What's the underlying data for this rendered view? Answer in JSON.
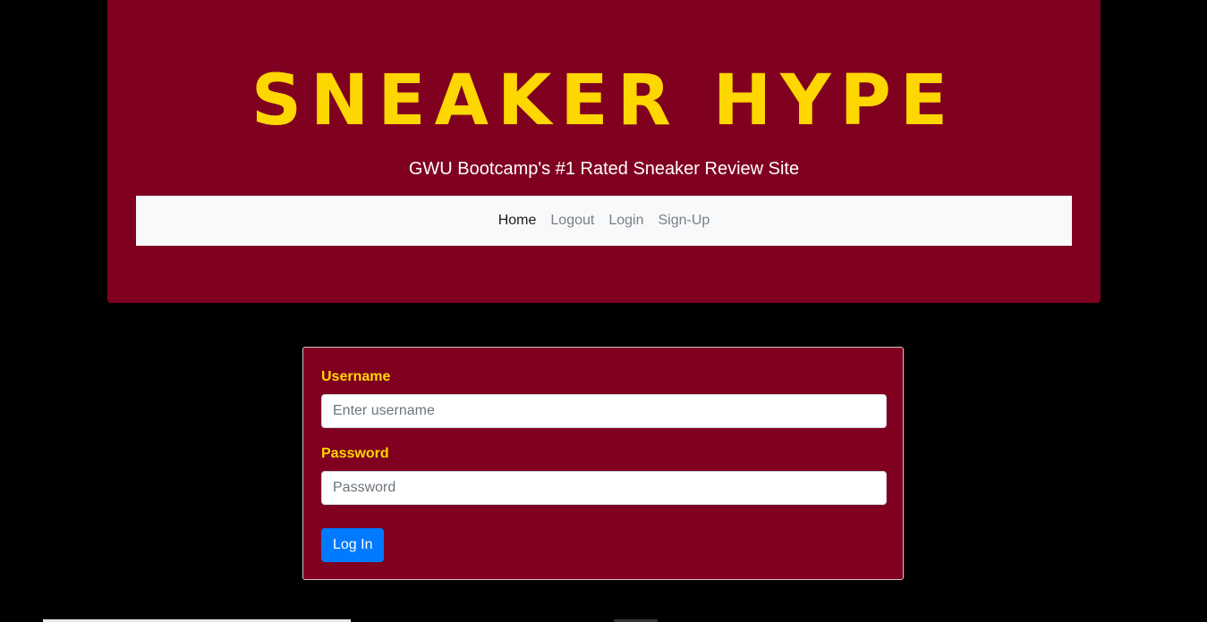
{
  "header": {
    "brand_title": "SNEAKER HYPE",
    "tagline": "GWU Bootcamp's #1 Rated Sneaker Review Site"
  },
  "nav": {
    "items": [
      {
        "label": "Home",
        "active": true
      },
      {
        "label": "Logout",
        "active": false
      },
      {
        "label": "Login",
        "active": false
      },
      {
        "label": "Sign-Up",
        "active": false
      }
    ]
  },
  "login_form": {
    "username_label": "Username",
    "username_placeholder": "Enter username",
    "username_value": "",
    "password_label": "Password",
    "password_placeholder": "Password",
    "password_value": "",
    "submit_label": "Log In"
  },
  "colors": {
    "background": "#000000",
    "brand_maroon": "#800020",
    "brand_gold": "#FFD700",
    "nav_background": "#f8f9fa",
    "button_primary": "#007bff"
  }
}
